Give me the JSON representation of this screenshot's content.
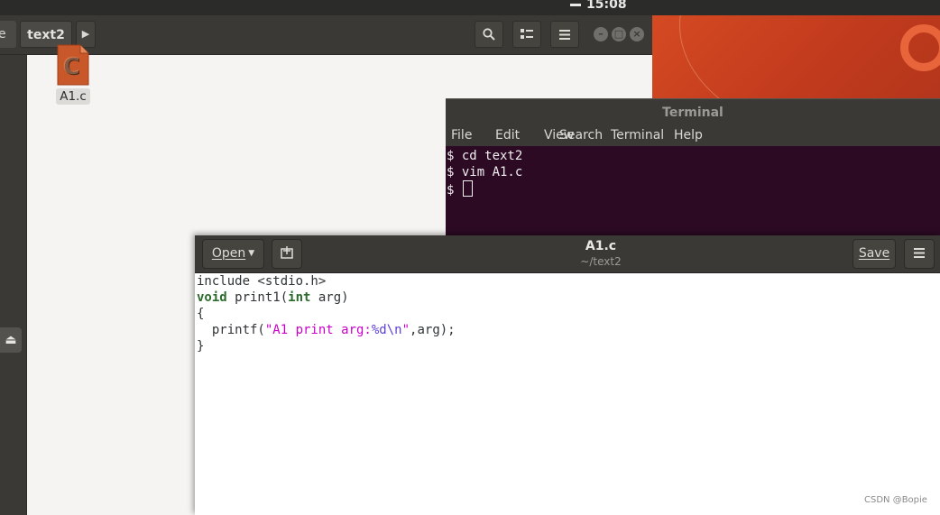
{
  "topbar": {
    "time": "15:08"
  },
  "file_manager": {
    "prev_tab_fragment": "e",
    "current_tab": "text2",
    "file": {
      "name": "A1.c",
      "icon": "c-source-file-icon"
    },
    "buttons": [
      "search-icon",
      "view-toggle-icon",
      "menu-icon"
    ],
    "window_controls": [
      "minimize",
      "maximize",
      "close"
    ]
  },
  "terminal": {
    "title": "Terminal",
    "menu": [
      "File",
      "Edit",
      "View",
      "Search",
      "Terminal",
      "Help"
    ],
    "lines": [
      "$ cd text2",
      "$ vim A1.c",
      "$ "
    ]
  },
  "gedit": {
    "open_label": "Open",
    "save_label": "Save",
    "title": "A1.c",
    "subtitle": "~/text2",
    "code": {
      "line1": "include <stdio.h>",
      "line2_kw": "void",
      "line2_rest": " print1(",
      "line2_kw2": "int",
      "line2_end": " arg)",
      "line3": "{",
      "line4_a": "  printf(",
      "line4_str": "\"A1 print arg:",
      "line4_esc1": "%d",
      "line4_esc2": "\\n",
      "line4_strend": "\"",
      "line4_end": ",arg);",
      "line5": "}"
    }
  },
  "watermark": "CSDN @Bopie",
  "colors": {
    "terminal_bg": "#2c0a24",
    "wallpaper": "#d44a22",
    "keyword": "#2b6b2b",
    "string": "#c800c8"
  }
}
